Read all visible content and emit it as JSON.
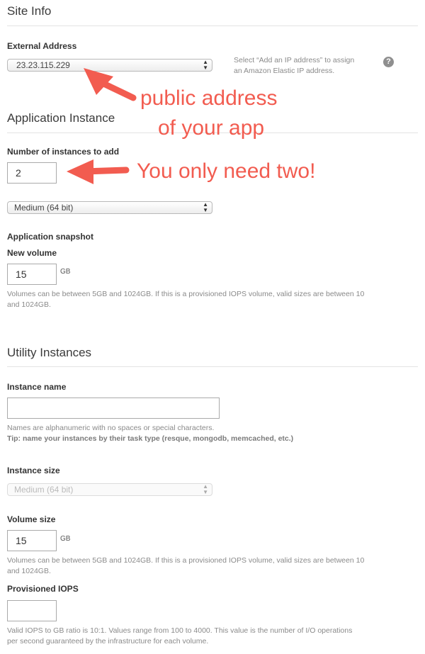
{
  "site_info": {
    "heading": "Site Info",
    "external_address_label": "External Address",
    "external_address_value": "23.23.115.229",
    "hint_line1": "Select “Add an IP address” to assign",
    "hint_line2": "an Amazon Elastic IP address."
  },
  "annotations": {
    "public_line1": "public address",
    "public_line2": "of your app",
    "two": "You only need two!"
  },
  "application_instance": {
    "heading": "Application Instance",
    "count_label": "Number of instances to add",
    "count_value": "2",
    "size_value": "Medium (64 bit)",
    "snapshot_label": "Application snapshot",
    "volume_label": "New volume",
    "volume_value": "15",
    "volume_unit": "GB",
    "volume_help_line1": "Volumes can be between 5GB and 1024GB. If this is a provisioned IOPS volume, valid sizes are between 10",
    "volume_help_line2": "and 1024GB."
  },
  "utility_instances": {
    "heading": "Utility Instances",
    "name_label": "Instance name",
    "name_value": "",
    "name_help_line1": "Names are alphanumeric with no spaces or special characters.",
    "name_tip": "Tip: name your instances by their task type (resque, mongodb, memcached, etc.)",
    "size_label": "Instance size",
    "size_value": "Medium (64 bit)",
    "volume_label": "Volume size",
    "volume_value": "15",
    "volume_unit": "GB",
    "volume_help_line1": "Volumes can be between 5GB and 1024GB. If this is a provisioned IOPS volume, valid sizes are between 10",
    "volume_help_line2": "and 1024GB.",
    "iops_label": "Provisioned IOPS",
    "iops_value": "",
    "iops_help_line1": "Valid IOPS to GB ratio is 10:1. Values range from 100 to 4000. This value is the number of I/O operations",
    "iops_help_line2": "per second guaranteed by the infrastructure for each volume."
  },
  "icons": {
    "help": "question-circle-icon",
    "arrow": "red-arrow-icon"
  },
  "colors": {
    "annotation": "#f25c50",
    "help_icon": "#8f8f8f"
  }
}
